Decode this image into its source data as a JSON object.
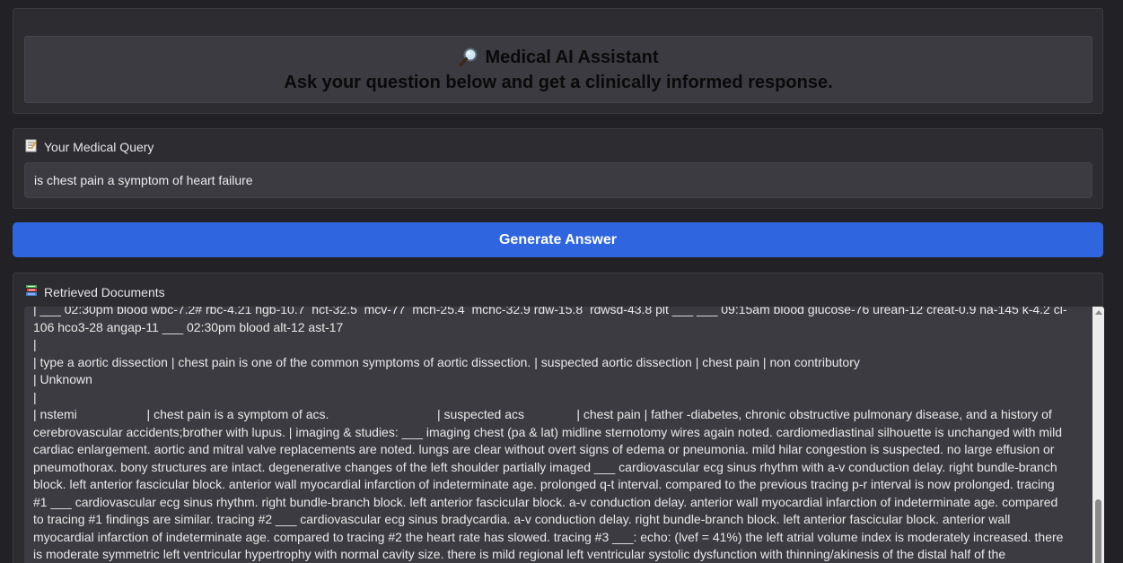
{
  "header": {
    "title_icon": "magnifier-icon",
    "title": "Medical AI Assistant",
    "subtitle": "Ask your question below and get a clinically informed response."
  },
  "query": {
    "label_icon": "memo-icon",
    "label": "Your Medical Query",
    "value": "is chest pain a symptom of heart failure"
  },
  "generate_button": {
    "label": "Generate Answer",
    "color": "#2f66e0"
  },
  "documents": {
    "label_icon": "books-icon",
    "label": "Retrieved Documents",
    "text": "| ___ 02:30pm blood wbc-7.2# rbc-4.21 hgb-10.7  hct-32.5  mcv-77  mch-25.4  mchc-32.9 rdw-15.8  rdwsd-43.8 plt ___ ___ 09:15am blood glucose-76 urean-12 creat-0.9 na-145 k-4.2 cl-106 hco3-28 angap-11 ___ 02:30pm blood alt-12 ast-17\n|\n| type a aortic dissection | chest pain is one of the common symptoms of aortic dissection. | suspected aortic dissection | chest pain | non contributory\n| Unknown\n|\n| nstemi                    | chest pain is a symptom of acs.                               | suspected acs               | chest pain | father -diabetes, chronic obstructive pulmonary disease, and a history of cerebrovascular accidents;brother with lupus. | imaging & studies: ___ imaging chest (pa & lat) midline sternotomy wires again noted. cardiomediastinal silhouette is unchanged with mild cardiac enlargement. aortic and mitral valve replacements are noted. lungs are clear without overt signs of edema or pneumonia. mild hilar congestion is suspected. no large effusion or pneumothorax. bony structures are intact. degenerative changes of the left shoulder partially imaged ___ cardiovascular ecg sinus rhythm with a-v conduction delay. right bundle-branch block. left anterior fascicular block. anterior wall myocardial infarction of indeterminate age. prolonged q-t interval. compared to the previous tracing p-r interval is now prolonged. tracing #1 ___ cardiovascular ecg sinus rhythm. right bundle-branch block. left anterior fascicular block. a-v conduction delay. anterior wall myocardial infarction of indeterminate age. compared to tracing #1 findings are similar. tracing #2 ___ cardiovascular ecg sinus bradycardia. a-v conduction delay. right bundle-branch block. left anterior fascicular block. anterior wall myocardial infarction of indeterminate age. compared to tracing #2 the heart rate has slowed. tracing #3 ___: echo: (lvef = 41%) the left atrial volume index is moderately increased. there is moderate symmetric left ventricular hypertrophy with normal cavity size. there is mild regional left ventricular systolic dysfunction with thinning/akinesis of the distal half of the"
  }
}
